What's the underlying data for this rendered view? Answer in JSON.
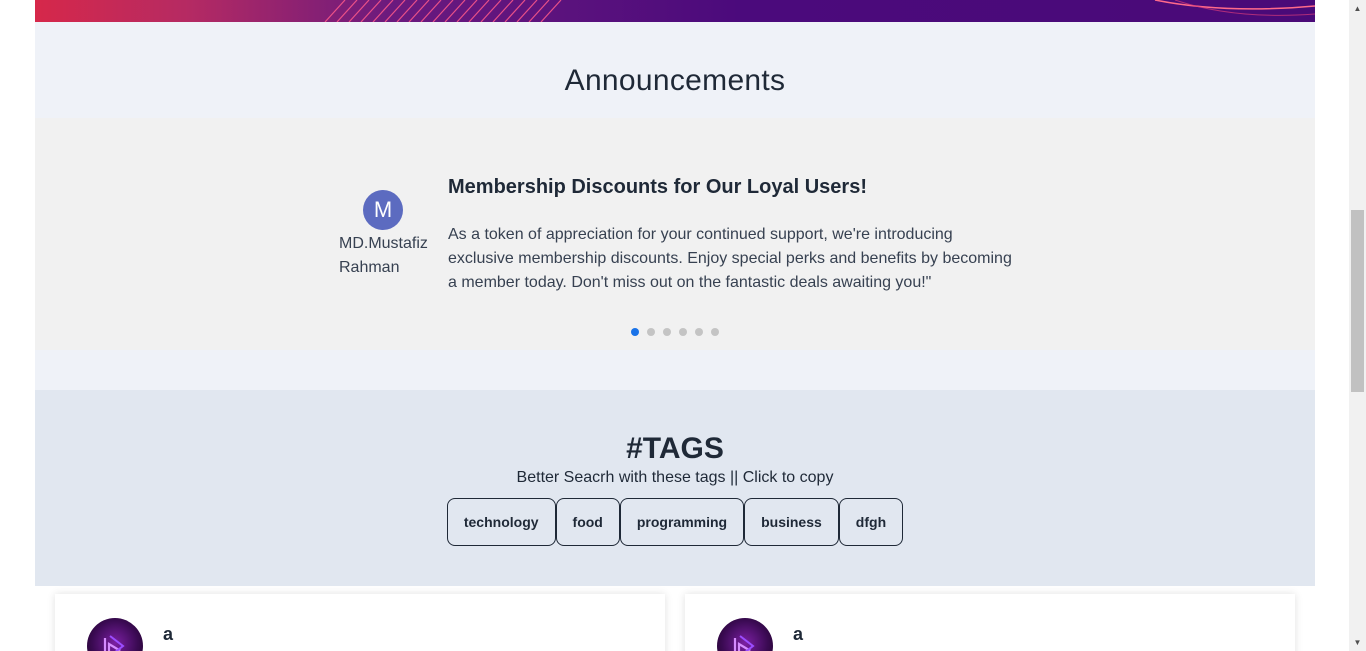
{
  "announcements": {
    "title": "Announcements",
    "slide": {
      "avatar_initial": "M",
      "author": "MD.Mustafiz Rahman",
      "title": "Membership Discounts for Our Loyal Users!",
      "body": "As a token of appreciation for your continued support, we're introducing exclusive membership discounts. Enjoy special perks and benefits by becoming a member today. Don't miss out on the fantastic deals awaiting you!\""
    },
    "dots": {
      "count": 6,
      "active_index": 0
    }
  },
  "tags": {
    "title": "#TAGS",
    "subtitle": "Better Seacrh with these tags || Click to copy",
    "items": [
      "technology",
      "food",
      "programming",
      "business",
      "dfgh"
    ]
  },
  "posts": [
    {
      "author": "a"
    },
    {
      "author": "a"
    }
  ],
  "colors": {
    "accent": "#1a73e8",
    "avatar": "#5c6bc0",
    "banner_start": "#d6284a",
    "banner_end": "#4a0a78"
  }
}
